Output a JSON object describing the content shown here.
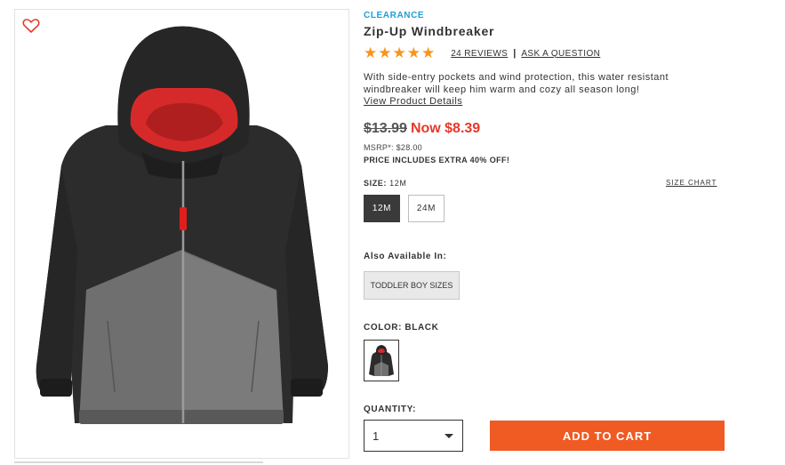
{
  "product": {
    "badge": "CLEARANCE",
    "title": "Zip-Up Windbreaker",
    "stars": "★★★★★",
    "reviews_link": "24 REVIEWS",
    "separator": "|",
    "ask_link": "ASK A QUESTION",
    "rating_value": 5,
    "description": "With side-entry pockets and wind protection, this water resistant windbreaker will keep him warm and cozy all season long!",
    "details_link": "View Product Details"
  },
  "price": {
    "original": "$13.99",
    "now": "Now $8.39",
    "msrp": "MSRP*: $28.00",
    "promo": "PRICE INCLUDES EXTRA 40% OFF!",
    "sale_color": "#e8382b"
  },
  "size": {
    "label": "SIZE:",
    "selected_value": "12M",
    "chart_link": "SIZE CHART",
    "options": [
      "12M",
      "24M"
    ]
  },
  "also_available": {
    "label": "Also Available In:",
    "option": "TODDLER BOY SIZES"
  },
  "color": {
    "label": "COLOR: BLACK"
  },
  "quantity": {
    "label": "QUANTITY:",
    "value": "1"
  },
  "cart": {
    "button_label": "ADD TO CART",
    "button_color": "#f05a23"
  },
  "icons": {
    "wishlist": "heart-outline-icon",
    "dropdown": "chevron-down-icon"
  }
}
